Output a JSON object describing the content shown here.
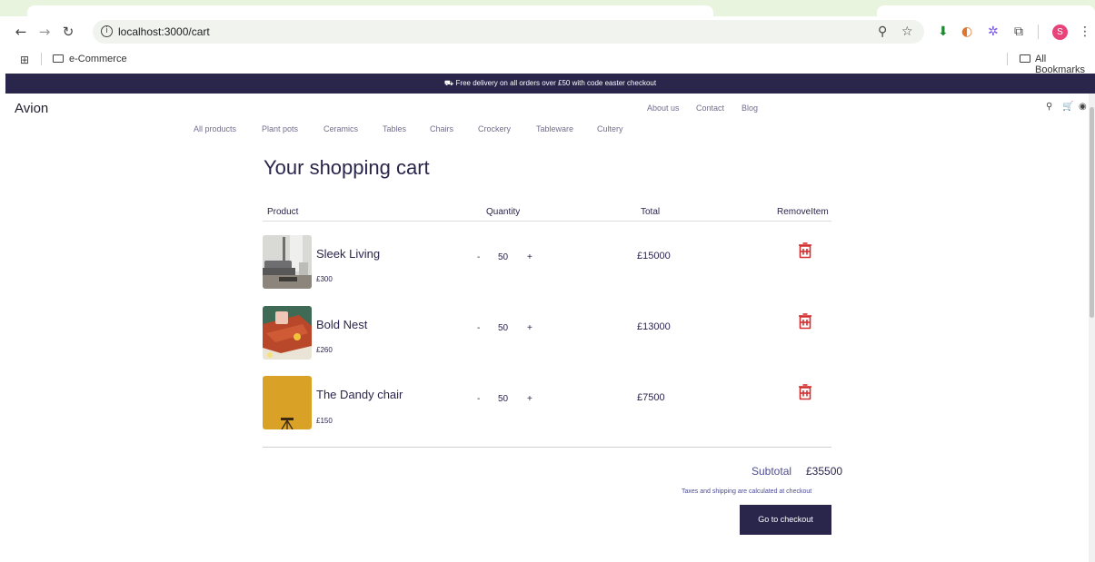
{
  "browser": {
    "url": "localhost:3000/cart",
    "profile_initial": "S",
    "bookmark_folder": "e-Commerce",
    "all_bookmarks": "All Bookmarks"
  },
  "site": {
    "banner": "Free delivery on all orders over £50 with code easter checkout",
    "logo": "Avion",
    "top_links": [
      "About us",
      "Contact",
      "Blog"
    ],
    "categories": [
      "All products",
      "Plant pots",
      "Ceramics",
      "Tables",
      "Chairs",
      "Crockery",
      "Tableware",
      "Cultery"
    ]
  },
  "cart": {
    "title": "Your shopping cart",
    "headers": {
      "product": "Product",
      "quantity": "Quantity",
      "total": "Total",
      "remove": "RemoveItem"
    },
    "items": [
      {
        "name": "Sleek Living",
        "price": "£300",
        "minus": "-",
        "qty": "50",
        "plus": "+",
        "total": "£15000"
      },
      {
        "name": "Bold Nest",
        "price": "£260",
        "minus": "-",
        "qty": "50",
        "plus": "+",
        "total": "£13000"
      },
      {
        "name": "The Dandy chair",
        "price": "£150",
        "minus": "-",
        "qty": "50",
        "plus": "+",
        "total": "£7500"
      }
    ],
    "subtotal_label": "Subtotal",
    "subtotal_value": "£35500",
    "tax_note": "Taxes and shipping are calculated at checkout",
    "checkout_label": "Go to checkout"
  },
  "colors": {
    "brand": "#2a254b",
    "accent_red": "#d32f2f",
    "muted": "#726e8d"
  }
}
